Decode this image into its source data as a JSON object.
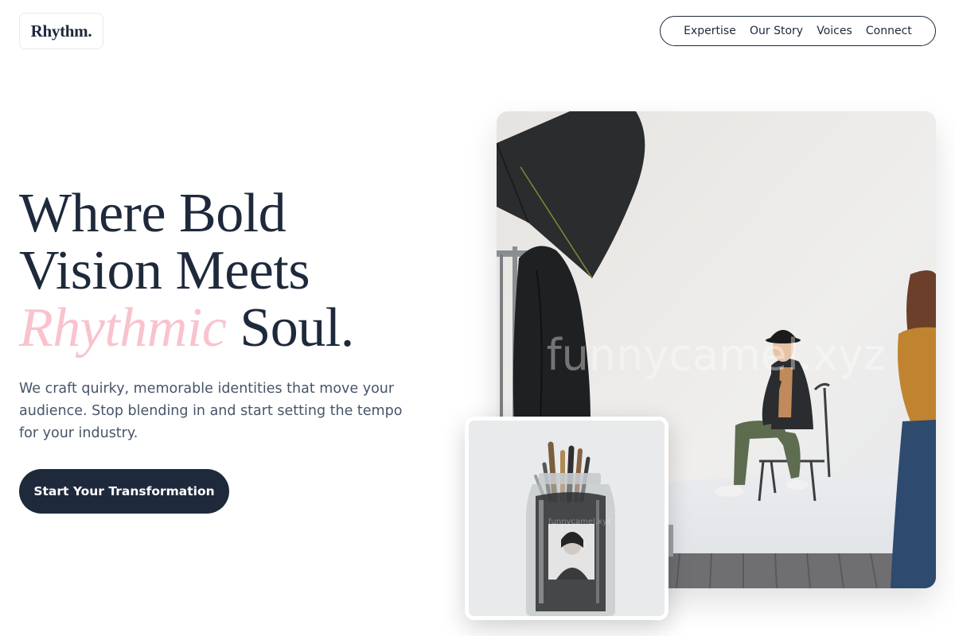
{
  "brand": {
    "logo_text": "Rhythm."
  },
  "nav": {
    "items": [
      {
        "label": "Expertise"
      },
      {
        "label": "Our Story"
      },
      {
        "label": "Voices"
      },
      {
        "label": "Connect"
      }
    ]
  },
  "hero": {
    "title_line1": "Where Bold",
    "title_line2": "Vision Meets",
    "title_accent": "Rhythmic",
    "title_end": "Soul.",
    "description": "We craft quirky, memorable identities that move your audience. Stop blending in and start setting the tempo for your industry.",
    "cta_label": "Start Your Transformation"
  },
  "images": {
    "main_watermark": "funnycamel.xyz",
    "small_watermark": "funnycamel.xyz"
  },
  "colors": {
    "primary": "#1e293b",
    "accent_pink": "#f8c3cd",
    "body_text": "#475569"
  }
}
